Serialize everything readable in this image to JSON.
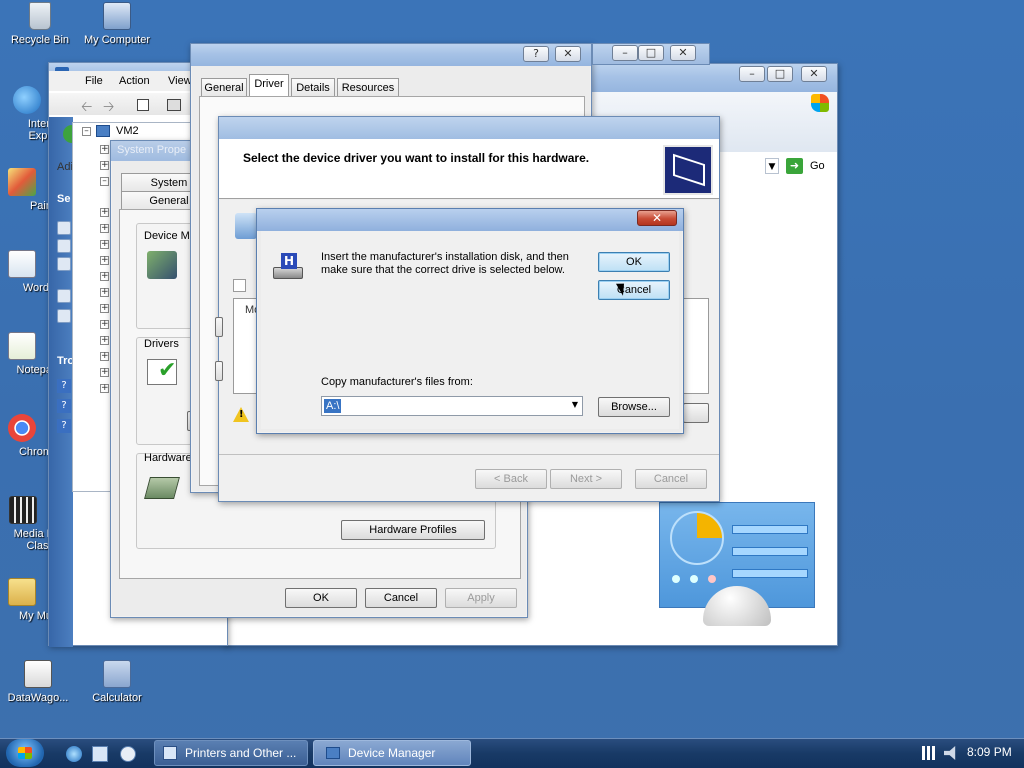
{
  "desktop": {
    "icons": [
      {
        "label": "Recycle Bin"
      },
      {
        "label": "My Computer"
      },
      {
        "label": "Internet Explorer",
        "short": "Intern\nExplo"
      },
      {
        "label": "Paint",
        "short": "Pain"
      },
      {
        "label": "WordPad",
        "short": "WordI"
      },
      {
        "label": "Notepad",
        "short": "Notepa"
      },
      {
        "label": "Chrome",
        "short": "Chrom"
      },
      {
        "label": "Media Player Classic",
        "short": "Media P\nClass"
      },
      {
        "label": "My Music",
        "short": "My Mu"
      },
      {
        "label": "DataWago...",
        "short": "DataWago..."
      },
      {
        "label": "Calculator",
        "short": "Calculator"
      }
    ]
  },
  "device_manager": {
    "menu": [
      "File",
      "Action",
      "View"
    ],
    "tree_root": "VM2",
    "left_labels": {
      "address_trunc": "Adi",
      "side_header": "Se",
      "tro": "Tro"
    }
  },
  "system_properties": {
    "title": "System Prope",
    "tabs_row1": [
      "System"
    ],
    "tabs_row2": [
      "General"
    ],
    "device_manager_label": "Device M",
    "drivers_label": "Drivers",
    "hardware_label": "Hardware",
    "hardware_profiles_button": "Hardware Profiles",
    "ok": "OK",
    "cancel": "Cancel",
    "apply": "Apply"
  },
  "device_props": {
    "tabs": [
      "General",
      "Driver",
      "Details",
      "Resources"
    ],
    "active_tab": "Driver"
  },
  "browser": {
    "go_label": "Go"
  },
  "wizard": {
    "header": "Select the device driver you want to install for this hardware.",
    "back": "< Back",
    "next": "Next >",
    "cancel": "Cancel",
    "partial_label": "Mo"
  },
  "install_disk": {
    "message": "Insert the manufacturer's installation disk, and then make sure that the correct drive is selected below.",
    "ok": "OK",
    "cancel": "Cancel",
    "copy_label": "Copy manufacturer's files from:",
    "path_value": "A:\\",
    "browse": "Browse..."
  },
  "taskbar": {
    "tasks": [
      "Printers and Other ...",
      "Device Manager"
    ],
    "clock": "8:09 PM"
  },
  "colors": {
    "accent": "#3c7fb1",
    "desktop": "#3a6fb0",
    "close": "#c84b35"
  }
}
